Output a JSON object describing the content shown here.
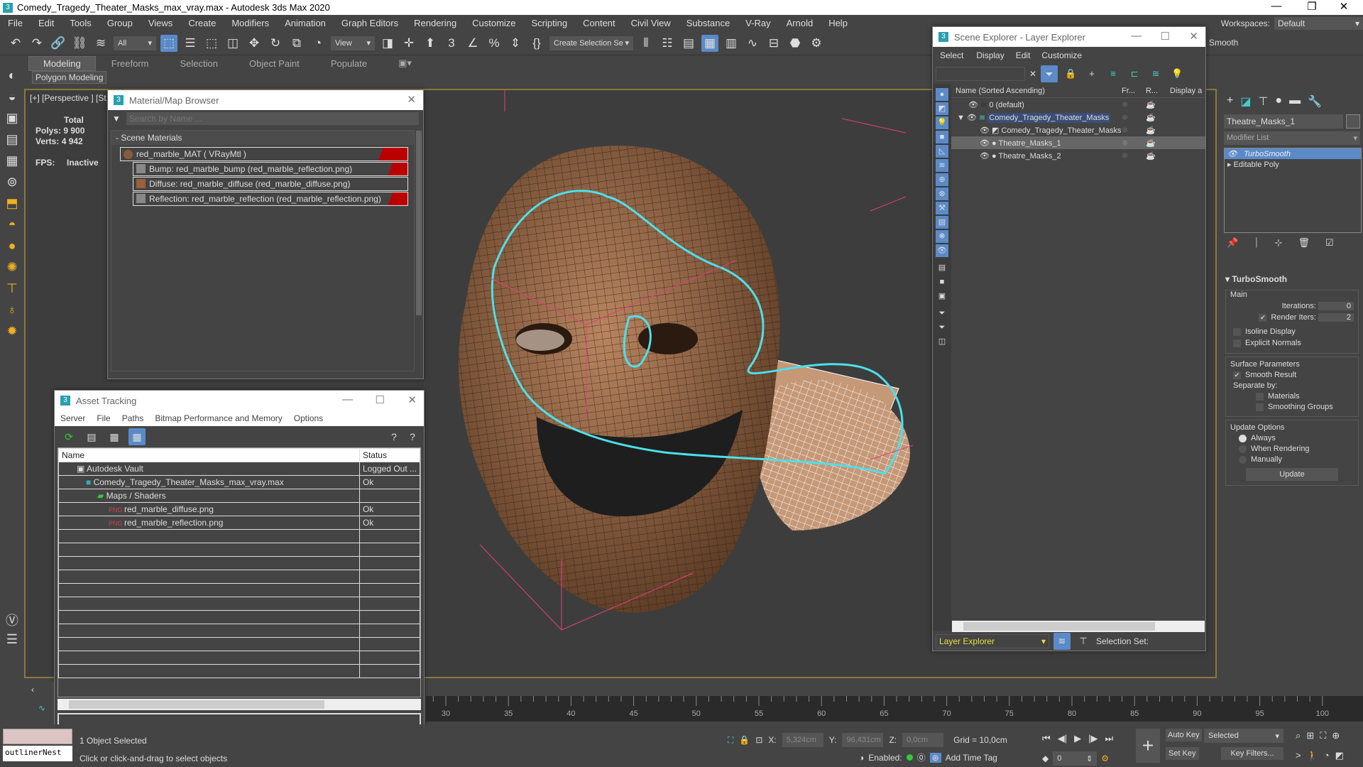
{
  "app": {
    "title": "Comedy_Tragedy_Theater_Masks_max_vray.max - Autodesk 3ds Max 2020",
    "app_icon": "3"
  },
  "menu": [
    "File",
    "Edit",
    "Tools",
    "Group",
    "Views",
    "Create",
    "Modifiers",
    "Animation",
    "Graph Editors",
    "Rendering",
    "Customize",
    "Scripting",
    "Content",
    "Civil View",
    "Substance",
    "V-Ray",
    "Arnold",
    "Help"
  ],
  "workspaces": {
    "label": "Workspaces:",
    "value": "Default"
  },
  "toolbar": {
    "filter": "All",
    "coord": "View",
    "selection_set": "Create Selection Se",
    "extra": "Smooth"
  },
  "ribbon": {
    "tabs": [
      "Modeling",
      "Freeform",
      "Selection",
      "Object Paint",
      "Populate"
    ],
    "active": "Modeling",
    "sub": "Polygon Modeling"
  },
  "viewport": {
    "label": "[+] [Perspective ] [St",
    "stats": {
      "total": "Total",
      "polys_label": "Polys:",
      "polys": "9 900",
      "verts_label": "Verts:",
      "verts": "4 942",
      "fps_label": "FPS:",
      "fps": "Inactive"
    }
  },
  "material_browser": {
    "title": "Material/Map Browser",
    "search_placeholder": "Search by Name ...",
    "group": "- Scene Materials",
    "items": [
      "red_marble_MAT  ( VRayMtl )",
      "Bump: red_marble_bump (red_marble_reflection.png)",
      "Diffuse: red_marble_diffuse (red_marble_diffuse.png)",
      "Reflection: red_marble_reflection (red_marble_reflection.png)"
    ]
  },
  "asset_tracking": {
    "title": "Asset Tracking",
    "menu": [
      "Server",
      "File",
      "Paths",
      "Bitmap Performance and Memory",
      "Options"
    ],
    "columns": [
      "Name",
      "Status"
    ],
    "rows": [
      {
        "name": "Autodesk Vault",
        "status": "Logged Out ..."
      },
      {
        "name": "Comedy_Tragedy_Theater_Masks_max_vray.max",
        "status": "Ok"
      },
      {
        "name": "Maps / Shaders",
        "status": ""
      },
      {
        "name": "red_marble_diffuse.png",
        "status": "Ok"
      },
      {
        "name": "red_marble_reflection.png",
        "status": "Ok"
      }
    ]
  },
  "scene_explorer": {
    "title": "Scene Explorer - Layer Explorer",
    "menu": [
      "Select",
      "Display",
      "Edit",
      "Customize"
    ],
    "columns": [
      "Name (Sorted Ascending)",
      "Fr...",
      "R...",
      "Display a"
    ],
    "rows": [
      "0 (default)",
      "Comedy_Tragedy_Theater_Masks",
      "Comedy_Tragedy_Theater_Masks",
      "Theatre_Masks_1",
      "Theatre_Masks_2"
    ],
    "footer": {
      "explorer": "Layer Explorer",
      "selection_set": "Selection Set:"
    }
  },
  "command_panel": {
    "object_name": "Theatre_Masks_1",
    "modifier_list": "Modifier List",
    "stack": [
      "TurboSmooth",
      "Editable Poly"
    ],
    "rollout": "TurboSmooth",
    "main": "Main",
    "iterations_label": "Iterations:",
    "iterations": "0",
    "render_iters_label": "Render Iters:",
    "render_iters": "2",
    "isoline": "Isoline Display",
    "explicit": "Explicit Normals",
    "surface": "Surface Parameters",
    "smooth_result": "Smooth Result",
    "separate": "Separate by:",
    "materials": "Materials",
    "smoothing_groups": "Smoothing Groups",
    "update_options": "Update Options",
    "always": "Always",
    "when_rendering": "When Rendering",
    "manually": "Manually",
    "update": "Update"
  },
  "timeline": {
    "ticks": [
      "30",
      "35",
      "40",
      "45",
      "50",
      "55",
      "60",
      "65",
      "70",
      "75",
      "80",
      "85",
      "90",
      "95",
      "100"
    ]
  },
  "status": {
    "maxscript": "outlinerNest",
    "selected": "1 Object Selected",
    "prompt": "Click or click-and-drag to select objects",
    "x_label": "X:",
    "x": "5,324cm",
    "y_label": "Y:",
    "y": "96,431cm",
    "z_label": "Z:",
    "z": "0,0cm",
    "grid": "Grid = 10,0cm",
    "enabled": "Enabled:",
    "add_time_tag": "Add Time Tag",
    "frame": "0",
    "auto_key": "Auto Key",
    "set_key": "Set Key",
    "key_mode": "Selected",
    "key_filters": "Key Filters..."
  }
}
